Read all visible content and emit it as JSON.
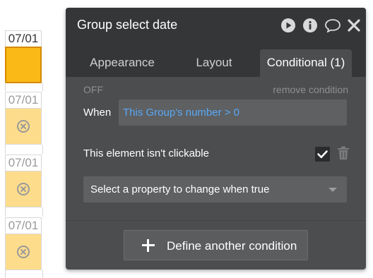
{
  "calendar": {
    "cells": [
      {
        "date": "07/01"
      },
      {
        "date": "07/01"
      },
      {
        "date": "07/01"
      },
      {
        "date": "07/01"
      }
    ]
  },
  "panel": {
    "title": "Group select date",
    "header_icons": [
      "play-icon",
      "info-icon",
      "comment-icon",
      "close-icon"
    ],
    "tabs": [
      {
        "label": "Appearance"
      },
      {
        "label": "Layout"
      },
      {
        "label": "Conditional (1)",
        "active": true
      }
    ],
    "condition": {
      "status": "OFF",
      "remove_label": "remove condition",
      "when_label": "When",
      "when_value": "This Group's number > 0",
      "clickable_label": "This element isn't clickable",
      "clickable_checked": true,
      "property_select": "Select a property to change when true"
    },
    "define_button": "Define another condition"
  },
  "colors": {
    "panel_bg": "#4c4d4f",
    "header_bg": "#343638",
    "expression_blue": "#5aa9f5",
    "cell_active": "#fbb917",
    "cell_light": "#fddc8c"
  }
}
